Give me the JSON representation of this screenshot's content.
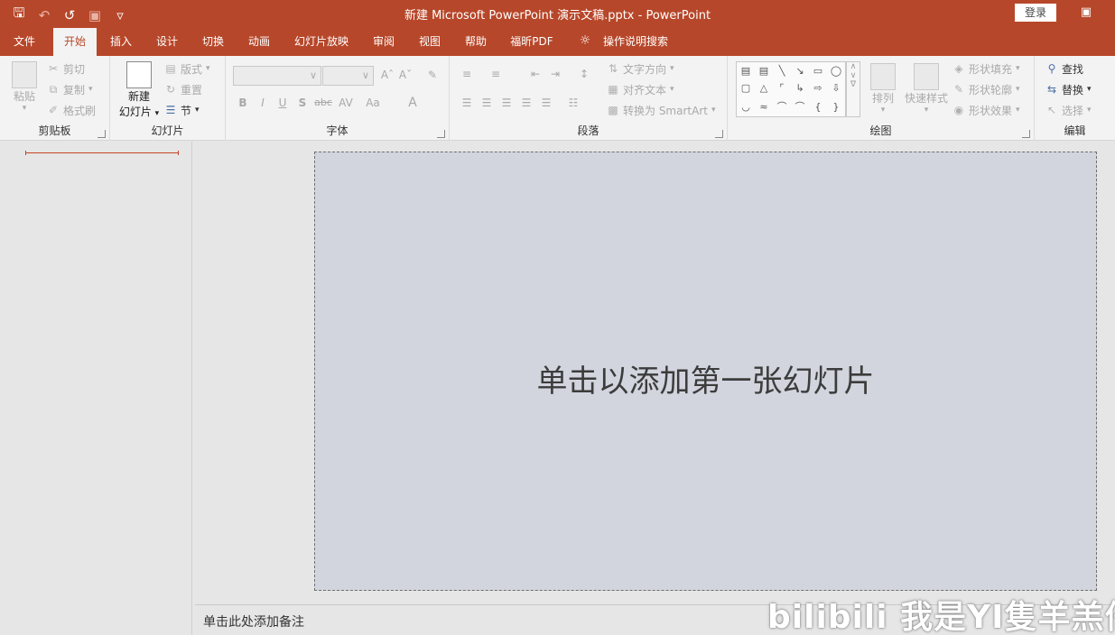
{
  "window": {
    "title": "新建 Microsoft PowerPoint 演示文稿.pptx  -  PowerPoint",
    "login_button": "登录",
    "ribbon_display_icon": "ribbon-display-options-icon"
  },
  "quick_access": [
    "save-icon",
    "undo-icon",
    "redo-icon",
    "present-icon",
    "customize-icon"
  ],
  "tabs": [
    {
      "label": "文件",
      "active": false
    },
    {
      "label": "开始",
      "active": true
    },
    {
      "label": "插入",
      "active": false
    },
    {
      "label": "设计",
      "active": false
    },
    {
      "label": "切换",
      "active": false
    },
    {
      "label": "动画",
      "active": false
    },
    {
      "label": "幻灯片放映",
      "active": false
    },
    {
      "label": "审阅",
      "active": false
    },
    {
      "label": "视图",
      "active": false
    },
    {
      "label": "帮助",
      "active": false
    },
    {
      "label": "福昕PDF",
      "active": false
    },
    {
      "label": "操作说明搜索",
      "active": false
    }
  ],
  "ribbon": {
    "clipboard": {
      "label": "剪贴板",
      "paste": "粘贴",
      "cut": "剪切",
      "copy": "复制",
      "format_painter": "格式刷"
    },
    "slides": {
      "label": "幻灯片",
      "new_slide_line1": "新建",
      "new_slide_line2": "幻灯片",
      "layout": "版式",
      "reset": "重置",
      "section": "节"
    },
    "font": {
      "label": "字体",
      "font_name": "",
      "font_size": "",
      "bold": "B",
      "italic": "I",
      "underline": "U",
      "shadow": "S",
      "strikethrough": "abc",
      "spacing": "AV",
      "change_case": "Aa",
      "color": "A"
    },
    "paragraph": {
      "label": "段落",
      "text_direction": "文字方向",
      "align_text": "对齐文本",
      "convert_smartart": "转换为 SmartArt"
    },
    "drawing": {
      "label": "绘图",
      "arrange": "排列",
      "quick_styles": "快速样式",
      "shape_fill": "形状填充",
      "shape_outline": "形状轮廓",
      "shape_effects": "形状效果"
    },
    "editing": {
      "label": "编辑",
      "find": "查找",
      "replace": "替换",
      "select": "选择"
    }
  },
  "slide": {
    "placeholder": "单击以添加第一张幻灯片"
  },
  "notes": {
    "placeholder": "单击此处添加备注"
  },
  "watermark": "bilibili 我是YI隻羊羔仔",
  "colors": {
    "accent": "#b7472a",
    "ribbon_bg": "#f3f3f3",
    "slide_bg": "#d2d5de"
  }
}
